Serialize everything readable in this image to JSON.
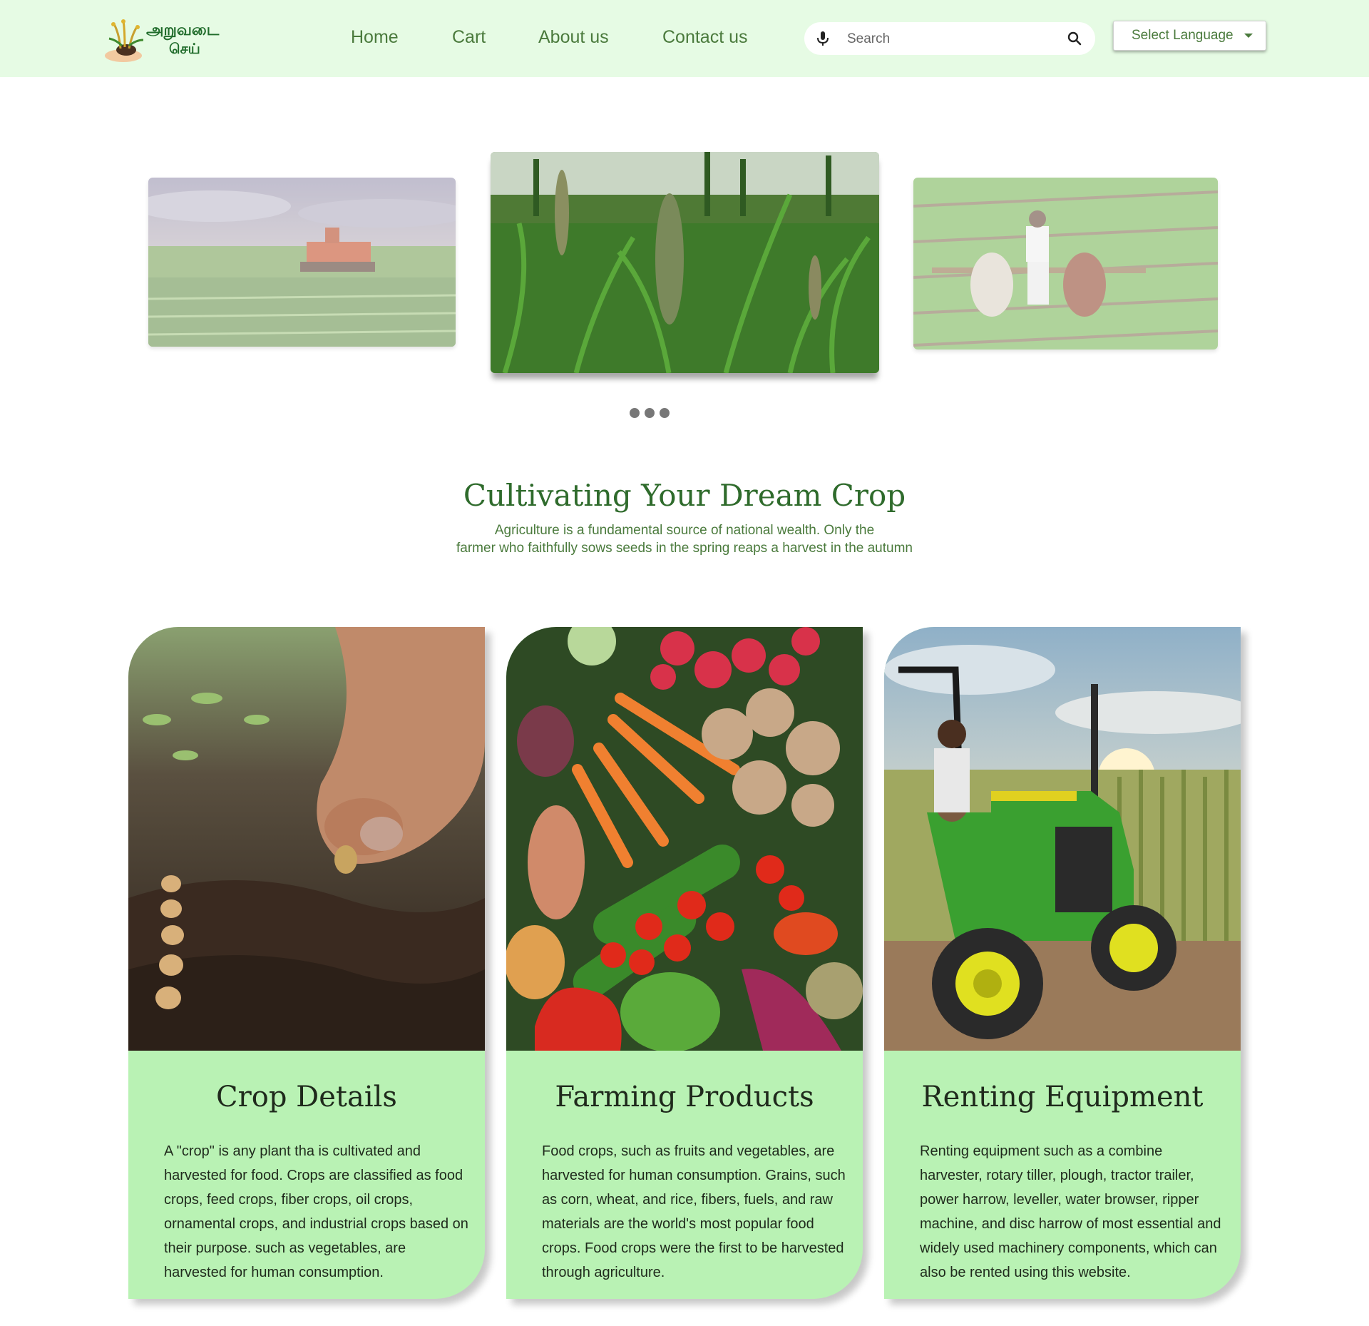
{
  "header": {
    "logo": {
      "line1": "அறுவடை",
      "line2": "செய்"
    },
    "nav": [
      {
        "label": "Home"
      },
      {
        "label": "Cart"
      },
      {
        "label": "About us"
      },
      {
        "label": "Contact us"
      }
    ],
    "search": {
      "placeholder": "Search"
    },
    "language": {
      "label": "Select Language"
    }
  },
  "carousel": {
    "slides": [
      {
        "icon": "tractor-field-photo"
      },
      {
        "icon": "millet-crop-photo"
      },
      {
        "icon": "ox-plough-photo"
      }
    ],
    "dots": 3
  },
  "intro": {
    "title": "Cultivating Your Dream Crop",
    "line1": "Agriculture is a fundamental source of national wealth. Only the",
    "line2": "farmer who faithfully sows seeds in the spring reaps a harvest in the autumn"
  },
  "cards": [
    {
      "title": "Crop Details",
      "text": "A \"crop\" is any plant tha is cultivated and harvested for food. Crops are classified as food crops, feed crops, fiber crops, oil crops, ornamental crops, and industrial crops based on their purpose. such as vegetables, are harvested for human consumption."
    },
    {
      "title": "Farming Products",
      "text": "Food crops, such as fruits and vegetables, are harvested for human consumption. Grains, such as corn, wheat, and rice, fibers, fuels, and raw materials are the world's most popular food crops. Food crops were the first to be harvested through agriculture."
    },
    {
      "title": "Renting Equipment",
      "text": "Renting equipment such as a combine harvester, rotary tiller, plough, tractor trailer, power harrow, leveller, water browser, ripper machine, and disc harrow of most essential and widely used machinery components, which can also be rented using this website."
    }
  ],
  "colors": {
    "header_bg": "#e6fbe4",
    "accent_green": "#2f6b2c",
    "card_bg": "#b9f2b4"
  }
}
